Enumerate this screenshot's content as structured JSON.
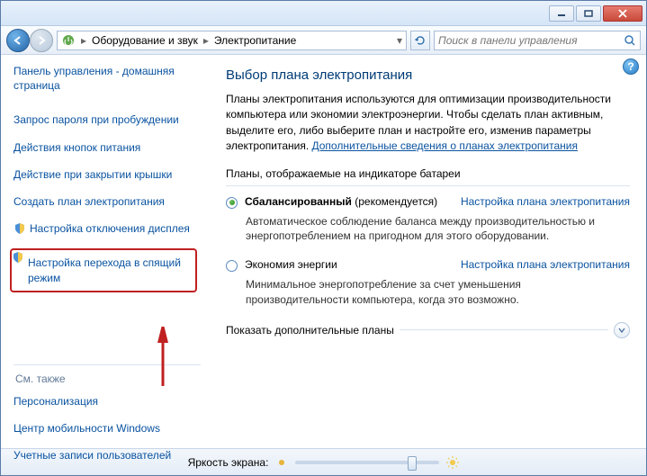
{
  "breadcrumb": {
    "item1": "Оборудование и звук",
    "item2": "Электропитание"
  },
  "search": {
    "placeholder": "Поиск в панели управления"
  },
  "sidebar": {
    "home": "Панель управления - домашняя страница",
    "items": [
      "Запрос пароля при пробуждении",
      "Действия кнопок питания",
      "Действие при закрытии крышки",
      "Создать план электропитания",
      "Настройка отключения дисплея",
      "Настройка перехода в спящий режим"
    ],
    "seealso_hdr": "См. также",
    "seealso": [
      "Персонализация",
      "Центр мобильности Windows",
      "Учетные записи пользователей"
    ]
  },
  "main": {
    "title": "Выбор плана электропитания",
    "desc_pre": "Планы электропитания используются для оптимизации производительности компьютера или экономии электроэнергии. Чтобы сделать план активным, выделите его, либо выберите план и настройте его, изменив параметры электропитания. ",
    "desc_link": "Дополнительные сведения о планах электропитания",
    "group_label": "Планы, отображаемые на индикаторе батареи",
    "plans": [
      {
        "name": "Сбалансированный",
        "suffix": "(рекомендуется)",
        "link": "Настройка плана электропитания",
        "desc": "Автоматическое соблюдение баланса между производительностью и энергопотреблением на пригодном для этого оборудовании.",
        "checked": true
      },
      {
        "name": "Экономия энергии",
        "suffix": "",
        "link": "Настройка плана электропитания",
        "desc": "Минимальное энергопотребление за счет уменьшения производительности компьютера, когда это возможно.",
        "checked": false
      }
    ],
    "show_more": "Показать дополнительные планы"
  },
  "footer": {
    "brightness_label": "Яркость экрана:",
    "brightness_pct": 78
  }
}
